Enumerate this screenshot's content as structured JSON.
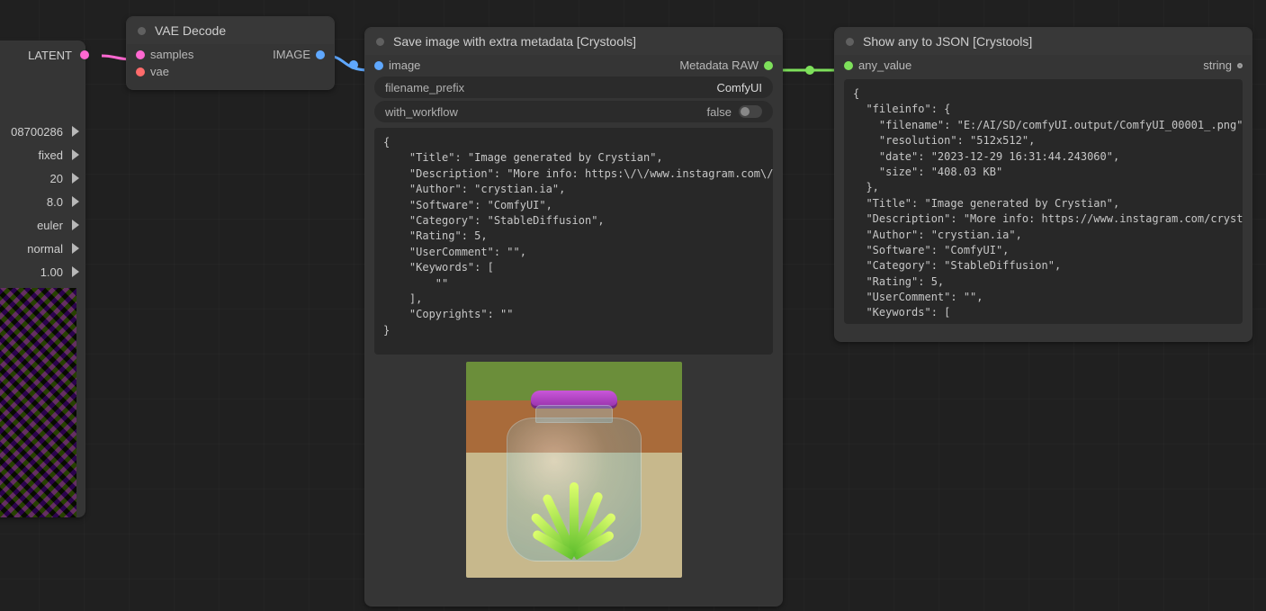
{
  "left_node": {
    "out_label": "LATENT",
    "rows": [
      "08700286",
      "fixed",
      "20",
      "8.0",
      "euler",
      "normal",
      "1.00"
    ]
  },
  "vae_node": {
    "title": "VAE Decode",
    "in_samples": "samples",
    "in_vae": "vae",
    "out_image": "IMAGE"
  },
  "save_node": {
    "title": "Save image with extra metadata [Crystools]",
    "in_image": "image",
    "out_meta": "Metadata RAW",
    "w_prefix_label": "filename_prefix",
    "w_prefix_value": "ComfyUI",
    "w_wf_label": "with_workflow",
    "w_wf_value": "false",
    "code": "{\n    \"Title\": \"Image generated by Crystian\",\n    \"Description\": \"More info: https:\\/\\/www.instagram.com\\/crystian.ia\",\n    \"Author\": \"crystian.ia\",\n    \"Software\": \"ComfyUI\",\n    \"Category\": \"StableDiffusion\",\n    \"Rating\": 5,\n    \"UserComment\": \"\",\n    \"Keywords\": [\n        \"\"\n    ],\n    \"Copyrights\": \"\"\n}"
  },
  "json_node": {
    "title": "Show any to JSON [Crystools]",
    "in_any": "any_value",
    "out_string": "string",
    "code": "{\n  \"fileinfo\": {\n    \"filename\": \"E:/AI/SD/comfyUI.output/ComfyUI_00001_.png\",\n    \"resolution\": \"512x512\",\n    \"date\": \"2023-12-29 16:31:44.243060\",\n    \"size\": \"408.03 KB\"\n  },\n  \"Title\": \"Image generated by Crystian\",\n  \"Description\": \"More info: https://www.instagram.com/crystian.ia\",\n  \"Author\": \"crystian.ia\",\n  \"Software\": \"ComfyUI\",\n  \"Category\": \"StableDiffusion\",\n  \"Rating\": 5,\n  \"UserComment\": \"\",\n  \"Keywords\": [\n    \"\"\n  ],\n  \"Copyrights\": \"\"\n}"
  }
}
